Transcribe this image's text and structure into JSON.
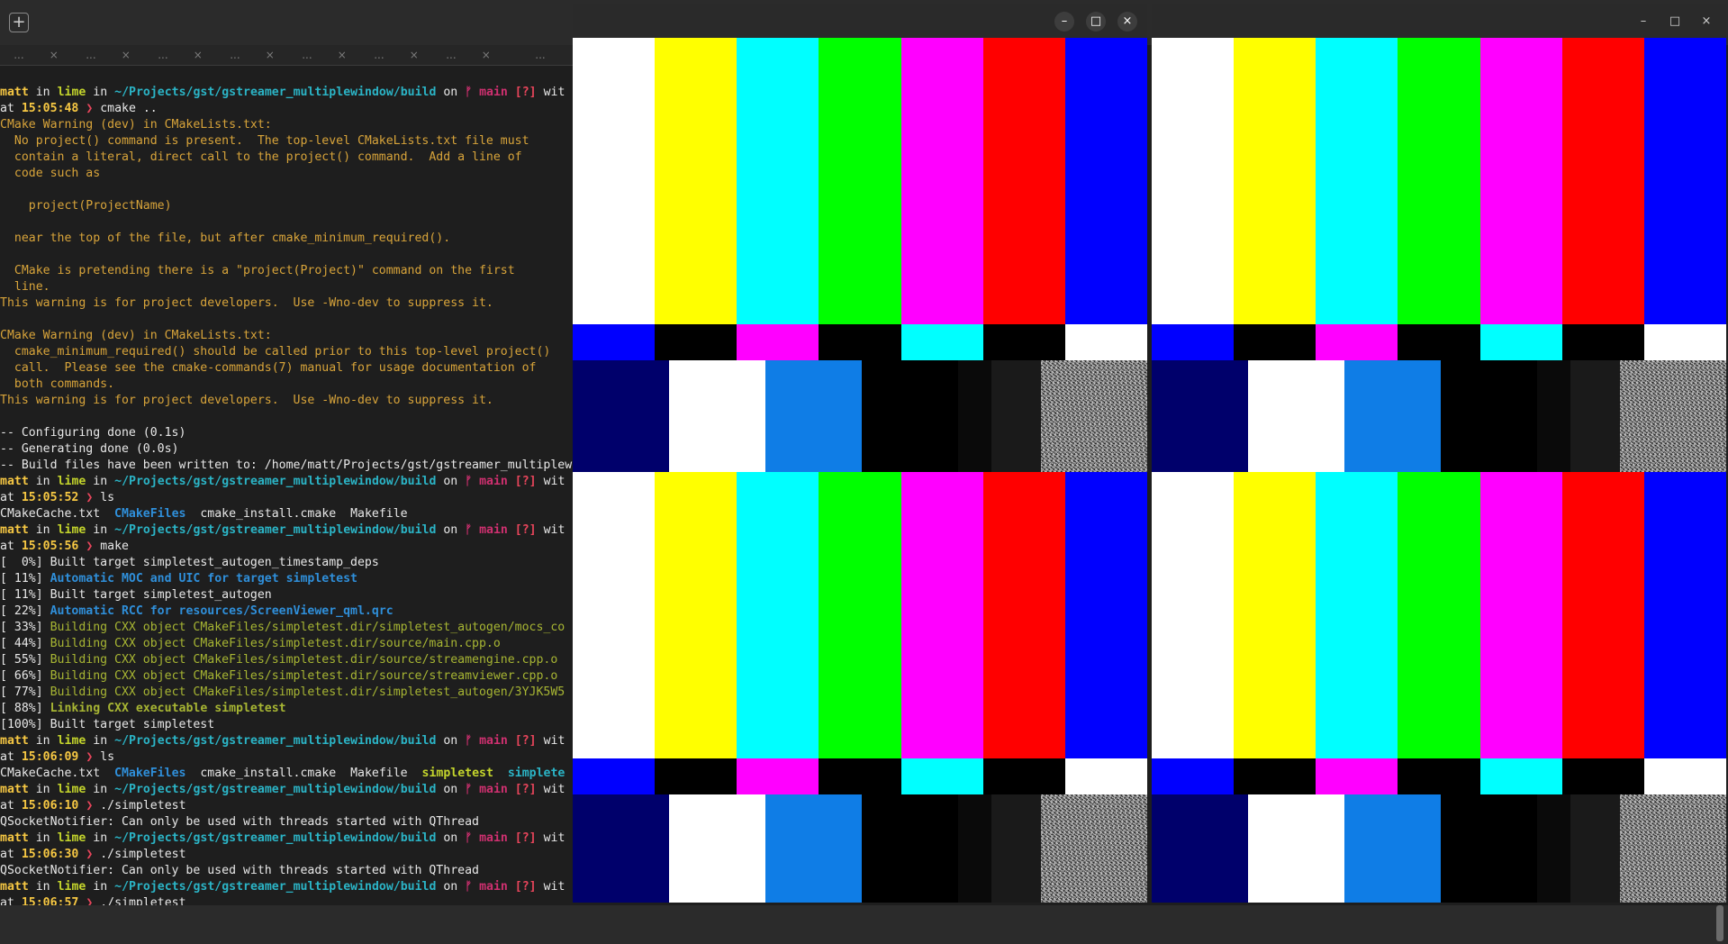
{
  "terminal": {
    "new_tab_symbol": "+",
    "tab_labels": [
      "...",
      "...",
      "...",
      "...",
      "...",
      "...",
      "...",
      "..."
    ],
    "tab_close": "×",
    "prompt": {
      "user": "matt",
      "host": "lime",
      "path": "~/Projects/gst/gstreamer_multiplewindow/build",
      "branch": "main",
      "status": "[?]",
      "with": "wit",
      "in": "in",
      "on": "on",
      "at": "at",
      "arrow": "❯"
    },
    "cmd1": {
      "time": "15:05:48",
      "cmd": "cmake .."
    },
    "warn1": [
      "CMake Warning (dev) in CMakeLists.txt:",
      "  No project() command is present.  The top-level CMakeLists.txt file must",
      "  contain a literal, direct call to the project() command.  Add a line of",
      "  code such as",
      "",
      "    project(ProjectName)",
      "",
      "  near the top of the file, but after cmake_minimum_required().",
      "",
      "  CMake is pretending there is a \"project(Project)\" command on the first",
      "  line."
    ],
    "dev_note": "This warning is for project developers.  Use -Wno-dev to suppress it.",
    "warn2": [
      "CMake Warning (dev) in CMakeLists.txt:",
      "  cmake_minimum_required() should be called prior to this top-level project()",
      "  call.  Please see the cmake-commands(7) manual for usage documentation of",
      "  both commands."
    ],
    "config": [
      "-- Configuring done (0.1s)",
      "-- Generating done (0.0s)",
      "-- Build files have been written to: /home/matt/Projects/gst/gstreamer_multiplew"
    ],
    "cmd2": {
      "time": "15:05:52",
      "cmd": "ls"
    },
    "ls1": {
      "f1": "CMakeCache.txt",
      "d1": "CMakeFiles",
      "f2": "cmake_install.cmake",
      "f3": "Makefile"
    },
    "cmd3": {
      "time": "15:05:56",
      "cmd": "make"
    },
    "make": {
      "l1_pct": "[  0%]",
      "l1": "Built target simpletest_autogen_timestamp_deps",
      "l2_pct": "[ 11%]",
      "l2": "Automatic MOC and UIC for target simpletest",
      "l3_pct": "[ 11%]",
      "l3": "Built target simpletest_autogen",
      "l4_pct": "[ 22%]",
      "l4": "Automatic RCC for resources/ScreenViewer_qml.qrc",
      "l5_pct": "[ 33%]",
      "l5": "Building CXX object CMakeFiles/simpletest.dir/simpletest_autogen/mocs_co",
      "l6_pct": "[ 44%]",
      "l6": "Building CXX object CMakeFiles/simpletest.dir/source/main.cpp.o",
      "l7_pct": "[ 55%]",
      "l7": "Building CXX object CMakeFiles/simpletest.dir/source/streamengine.cpp.o",
      "l8_pct": "[ 66%]",
      "l8": "Building CXX object CMakeFiles/simpletest.dir/source/streamviewer.cpp.o",
      "l9_pct": "[ 77%]",
      "l9": "Building CXX object CMakeFiles/simpletest.dir/simpletest_autogen/3YJK5W5",
      "l10_pct": "[ 88%]",
      "l10": "Linking CXX executable simpletest",
      "l11": "[100%] Built target simpletest"
    },
    "cmd4": {
      "time": "15:06:09",
      "cmd": "ls"
    },
    "ls2": {
      "f1": "CMakeCache.txt",
      "d1": "CMakeFiles",
      "f2": "cmake_install.cmake",
      "f3": "Makefile",
      "x1": "simpletest",
      "x2": "simplete"
    },
    "cmd5": {
      "time": "15:06:10",
      "cmd": "./simpletest"
    },
    "cmd6": {
      "time": "15:06:30",
      "cmd": "./simpletest"
    },
    "cmd7": {
      "time": "15:06:57",
      "cmd": "./simpletest"
    },
    "qsocket": "QSocketNotifier: Can only be used with threads started with QThread"
  },
  "video_windows": {
    "minimize": "–",
    "maximize": "□",
    "close": "×"
  },
  "colors": {
    "bars_top": [
      "#ffffff",
      "#ffff00",
      "#00ffff",
      "#00ff00",
      "#ff00ff",
      "#ff0000",
      "#0000ff"
    ],
    "bars_mid": [
      "#0000ff",
      "#000000",
      "#ff00ff",
      "#000000",
      "#00ffff",
      "#000000",
      "#ffffff"
    ],
    "bars_bottom": [
      "#00006b",
      "#ffffff",
      "#0f7de6",
      "#000000",
      "#0a0a0a",
      "#1a1a1a"
    ]
  }
}
